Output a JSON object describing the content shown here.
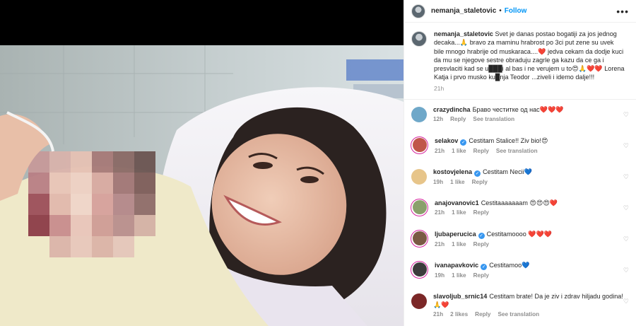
{
  "header": {
    "username": "nemanja_staletovic",
    "separator": "•",
    "follow_label": "Follow",
    "more_icon": "more-horizontal-icon"
  },
  "caption": {
    "username": "nemanja_staletovic",
    "text": "Svet je danas postao bogatiji za jos jednog decaka...🙏 bravo za maminu hrabrost po 3ci put zene su uvek bile mnogo hrabrije od muskaraca....❤️ jedva cekam da dodje kuci da mu se njegove sestre obraduju zagrle ga kazu da ce ga i presvlaciti kad se u███i al bas i ne verujem u to😍🙏❤️❤️ Lorena Katja i prvo musko ku█nja Teodor ...ziveli i idemo dalje!!!",
    "time": "21h"
  },
  "comments": [
    {
      "username": "crazydincha",
      "verified": false,
      "text": "Браво честитке од нас❤️❤️❤️",
      "time": "12h",
      "likes": "",
      "reply": "Reply",
      "translation": "See translation",
      "avatar_color": "#6fa8c9",
      "ring": false
    },
    {
      "username": "selakov",
      "verified": true,
      "text": "Cestitam Stalice!! Ziv bio!😍",
      "time": "21h",
      "likes": "1 like",
      "reply": "Reply",
      "translation": "See translation",
      "avatar_color": "#c0564a",
      "ring": true
    },
    {
      "username": "kostovjelena",
      "verified": true,
      "text": "Cestitam Necii💙",
      "time": "19h",
      "likes": "1 like",
      "reply": "Reply",
      "translation": "",
      "avatar_color": "#e7c58a",
      "ring": false
    },
    {
      "username": "anajovanovic1",
      "verified": false,
      "text": "Cestitaaaaaaam 😍😍😍❤️",
      "time": "21h",
      "likes": "1 like",
      "reply": "Reply",
      "translation": "",
      "avatar_color": "#8aa06b",
      "ring": true
    },
    {
      "username": "ljubaperucica",
      "verified": true,
      "text": "Cestitamoooo ❤️❤️❤️",
      "time": "21h",
      "likes": "1 like",
      "reply": "Reply",
      "translation": "",
      "avatar_color": "#7a5a44",
      "ring": true
    },
    {
      "username": "ivanapavkovic",
      "verified": true,
      "text": "Cestitamoo💙",
      "time": "19h",
      "likes": "1 like",
      "reply": "Reply",
      "translation": "",
      "avatar_color": "#3c3c3c",
      "ring": true
    },
    {
      "username": "slavoljub_srnic14",
      "verified": false,
      "text": "Cestitam brate! Da je ziv i zdrav hiljadu godina!🙏❤️",
      "time": "21h",
      "likes": "2 likes",
      "reply": "Reply",
      "translation": "See translation",
      "avatar_color": "#7b2727",
      "ring": false
    }
  ],
  "icons": {
    "like": "heart-outline-icon",
    "verified": "verified-badge-icon"
  },
  "colors": {
    "link_blue": "#0095f6",
    "muted": "#8e8e8e",
    "text": "#262626",
    "verified": "#3897f0",
    "story_ring": "#d6249f"
  }
}
